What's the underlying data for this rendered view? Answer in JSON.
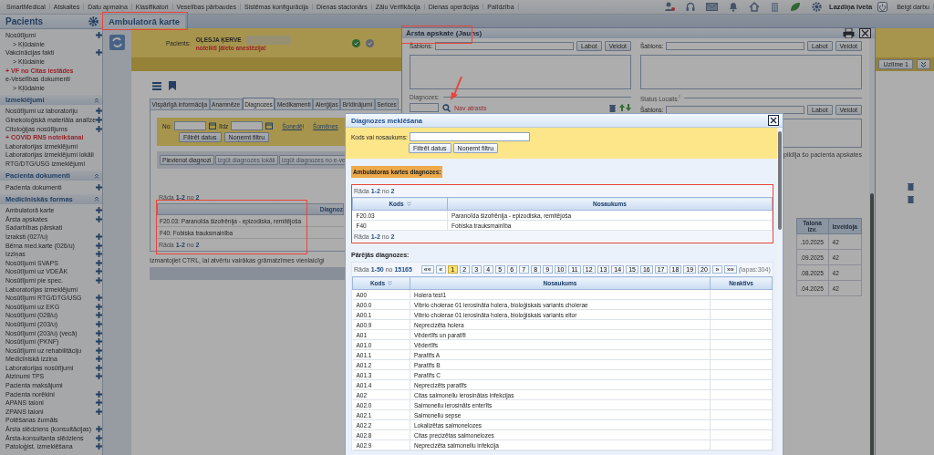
{
  "top_menu": {
    "items": [
      "SmartMedical",
      "Atskaites",
      "Datu apmaiņa",
      "Klasifikatori",
      "Veselības pārbaudes",
      "Sistēmas konfigurācija",
      "Dienas stacionārs",
      "Zāļu Verifikācija",
      "Dienas operācijas",
      "Palīdzība"
    ],
    "user": "Lazdiņa Iveta",
    "logout": "Beigt darbu"
  },
  "sidebar": {
    "title": "Pacients",
    "sections": [
      {
        "items": [
          {
            "label": "Nosūtījumi",
            "kind": "link",
            "add": true
          },
          {
            "label": "> Kļūdainie",
            "kind": "sub",
            "add": false
          },
          {
            "label": "Vakcinācijas fakti",
            "kind": "link",
            "add": true
          },
          {
            "label": "> Kļūdainie",
            "kind": "sub",
            "add": false
          },
          {
            "label": "+ VF no Citas iestādes",
            "kind": "alert",
            "add": false
          },
          {
            "label": "e-Veselības dokumenti",
            "kind": "link",
            "add": false
          },
          {
            "label": "> Kļūdainie",
            "kind": "sub",
            "add": false
          }
        ]
      },
      {
        "title": "Izmeklējumi",
        "items": [
          {
            "label": "Nosūtījumi uz laboratoriju",
            "kind": "link",
            "add": true
          },
          {
            "label": "Ginekoloģiskā materiāla analīze",
            "kind": "link",
            "add": true
          },
          {
            "label": "Citoloģijas nosūtījums",
            "kind": "link",
            "add": true
          },
          {
            "label": "+ COVID RNS noteikšanai",
            "kind": "alert",
            "add": false
          },
          {
            "label": "Laboratorijas izmeklējumi",
            "kind": "link",
            "add": false
          },
          {
            "label": "Laboratorijas izmeklējumi lokāli",
            "kind": "link",
            "add": false
          },
          {
            "label": "RTG/DTG/USG izmeklējumi",
            "kind": "link",
            "add": false
          }
        ]
      },
      {
        "title": "Pacienta dokumenti",
        "items": [
          {
            "label": "Pacienta dokumenti",
            "kind": "link",
            "add": true
          }
        ]
      },
      {
        "title": "Medicīniskās formas",
        "items": [
          {
            "label": "Ambulatorā karte",
            "kind": "link",
            "add": true
          },
          {
            "label": "Ārsta apskates",
            "kind": "link",
            "add": true
          },
          {
            "label": "Sadarbības pārskati",
            "kind": "link",
            "add": false
          },
          {
            "label": "Izraksti (027/u)",
            "kind": "link",
            "add": true
          },
          {
            "label": "Bērna med.karte (026/u)",
            "kind": "link",
            "add": true
          },
          {
            "label": "Izziņas",
            "kind": "link",
            "add": true
          },
          {
            "label": "Nosūtījumi SVAPS",
            "kind": "link",
            "add": true
          },
          {
            "label": "Nosūtījumi uz VDEĀK",
            "kind": "link",
            "add": true
          },
          {
            "label": "Nosūtījumi pie spec.",
            "kind": "link",
            "add": true
          },
          {
            "label": "Laboratorijas izmeklējumi",
            "kind": "link",
            "add": false
          },
          {
            "label": "Nosūtījumi RTG/DTG/USG",
            "kind": "link",
            "add": true
          },
          {
            "label": "Nosūtījumi uz EKG",
            "kind": "link",
            "add": true
          },
          {
            "label": "Nosūtījumi (028/u)",
            "kind": "link",
            "add": true
          },
          {
            "label": "Nosūtījumi (203/u)",
            "kind": "link",
            "add": true
          },
          {
            "label": "Nosūtījumi (203/u) (vecā)",
            "kind": "link",
            "add": true
          },
          {
            "label": "Nosūtījumi (PKNF)",
            "kind": "link",
            "add": true
          },
          {
            "label": "Nosūtījumi uz rehabilitāciju",
            "kind": "link",
            "add": true
          },
          {
            "label": "Medicīniskā izziņa",
            "kind": "link",
            "add": true
          },
          {
            "label": "Laboratorijas nosūtījumi",
            "kind": "link",
            "add": true
          },
          {
            "label": "Atzinumi TPS",
            "kind": "link",
            "add": true
          },
          {
            "label": "Pacienta maksājumi",
            "kind": "link",
            "add": false
          },
          {
            "label": "Pacienta norēķini",
            "kind": "link",
            "add": true
          },
          {
            "label": "APANS taloni",
            "kind": "link",
            "add": true
          },
          {
            "label": "ZPANS taloni",
            "kind": "link",
            "add": true
          },
          {
            "label": "Potēšanas žurnāls",
            "kind": "link",
            "add": false
          },
          {
            "label": "Ārsta slēdziens (konsultācijas)",
            "kind": "link",
            "add": true
          },
          {
            "label": "Ārsta-konsultanta slēdziens",
            "kind": "link",
            "add": true
          },
          {
            "label": "Patoloģist. izmeklēšana",
            "kind": "link",
            "add": true
          }
        ]
      }
    ]
  },
  "page": {
    "title": "Ambulatorā karte",
    "patient_label": "Pacients:",
    "patient_name": "OĻESJA ĶERVE",
    "patient_warning": "noteikti jāleto anestēzija!",
    "sticker_button": "Uzlīme 1",
    "tabs": [
      {
        "label": "Vispārīgā informācija",
        "selected": false
      },
      {
        "label": "Anamnēze",
        "selected": false
      },
      {
        "label": "Diagnozes",
        "selected": true
      },
      {
        "label": "Medikamenti",
        "selected": false
      },
      {
        "label": "Alerģijas",
        "selected": false
      },
      {
        "label": "Brīdinājumi",
        "selected": false
      },
      {
        "label": "Serices",
        "selected": false
      }
    ],
    "filter": {
      "from_label": "No:",
      "to_label": "līdz",
      "links": [
        "Šonedēļ",
        "Šomēnes"
      ],
      "buttons": [
        "Filtrēt datus",
        "Noņemt filtru"
      ]
    },
    "actions": [
      {
        "label": "Pievienot diagnozi",
        "disabled": false
      },
      {
        "label": "Izgūt diagnozes lokāli",
        "disabled": true
      },
      {
        "label": "Izgūt diagnozes no e-ve",
        "disabled": true
      }
    ],
    "count_top": "Rāda **1-2** no **2**",
    "column": "Diagnoz",
    "rows": [
      "F20.03: Paranoīda šizofrēnija - epizodiska, remitējoša",
      "F40: Fobiska trauksmainība"
    ],
    "count_bottom": "Rāda **1-2** no **2**",
    "hint": "Izmantojiet CTRL, lai atvērtu vairākas grāmatzīmes vienlaicīgi"
  },
  "exam_window": {
    "title": "Ārsta apskate (Jauns)",
    "template_label": "Šablons:",
    "buttons": [
      "Labot",
      "Veidot"
    ],
    "diagnoses_label": "Diagnozes:",
    "not_found": "Nav atrasts",
    "status_label": "Status Localis:$^{!}$",
    "right_column": {
      "template_label": "Šablons:",
      "buttons": [
        "Labot",
        "Veidot"
      ]
    },
    "right_template_label": "Šablons:",
    "right_buttons": [
      "Labot",
      "Veidot"
    ],
    "partial_note": "pildīja šo pacienta apskates",
    "table": {
      "columns": [
        "Talona izv.",
        "Izveidoja"
      ],
      "rows": [
        [
          ".10.2025",
          "42"
        ],
        [
          ".09.2025",
          "42"
        ],
        [
          ".08.2025",
          "42"
        ],
        [
          ".04.2025",
          "42"
        ]
      ]
    }
  },
  "dialog": {
    "title": "Diagnozes meklēšana",
    "search_label": "Kods vai nosaukums:",
    "buttons": [
      "Filtrēt datus",
      "Noņemt filtru"
    ],
    "card_label": "Ambulatoras kartes diagnozes:",
    "card_count_top": "Rāda **1-2** no **2**",
    "card_columns": [
      "Kods",
      "Nosaukums"
    ],
    "card_rows": [
      [
        "F20.03",
        "Paranoīda šizofrēnija - epizodiska, remitējoša"
      ],
      [
        "F40",
        "Fobiska trauksmainība"
      ]
    ],
    "card_count_bottom": "Rāda **1-2** no **2**",
    "other_label": "Pārējās diagnozes:",
    "other_count": "Rāda **1-50** no **15165**",
    "pager": {
      "first": "««",
      "prev": "«",
      "next": "»",
      "last": "»»",
      "pages": [
        {
          "label": "1",
          "selected": true
        },
        {
          "label": "2",
          "selected": false
        },
        {
          "label": "3",
          "selected": false
        },
        {
          "label": "4",
          "selected": false
        },
        {
          "label": "5",
          "selected": false
        },
        {
          "label": "6",
          "selected": false
        },
        {
          "label": "7",
          "selected": false
        },
        {
          "label": "8",
          "selected": false
        },
        {
          "label": "9",
          "selected": false
        },
        {
          "label": "10",
          "selected": false
        },
        {
          "label": "11",
          "selected": false
        },
        {
          "label": "12",
          "selected": false
        },
        {
          "label": "13",
          "selected": false
        },
        {
          "label": "14",
          "selected": false
        },
        {
          "label": "15",
          "selected": false
        },
        {
          "label": "16",
          "selected": false
        },
        {
          "label": "17",
          "selected": false
        },
        {
          "label": "18",
          "selected": false
        },
        {
          "label": "19",
          "selected": false
        },
        {
          "label": "20",
          "selected": false
        }
      ],
      "total": "(lapas:304)"
    },
    "columns": [
      "Kods",
      "Nosaukums",
      "Neaktīvs"
    ],
    "rows": [
      [
        "A00",
        "Holera test1"
      ],
      [
        "A00.0",
        "Vibrio cholerae 01 ierosināta holera, bioloģiskais variants cholerae"
      ],
      [
        "A00.1",
        "Vibrio cholerae 01 ierosināta holera, bioloģiskais variants eltor"
      ],
      [
        "A00.9",
        "Neprecizēta holera"
      ],
      [
        "A01",
        "Vēdertīfs un paratīfi"
      ],
      [
        "A01.0",
        "Vēdertīfs"
      ],
      [
        "A01.1",
        "Paratīfs A"
      ],
      [
        "A01.2",
        "Paratīfs B"
      ],
      [
        "A01.3",
        "Paratīfs C"
      ],
      [
        "A01.4",
        "Neprecizēts paratīfs"
      ],
      [
        "A02",
        "Citas salmonellu ierosinātas infekcijas"
      ],
      [
        "A02.0",
        "Salmonellu ierosināts enterīts"
      ],
      [
        "A02.1",
        "Salmonellu sepse"
      ],
      [
        "A02.2",
        "Lokalizētas salmonelozes"
      ],
      [
        "A02.8",
        "Citas precizētas salmonelozes"
      ],
      [
        "A02.9",
        "Neprecizēta salmonellu infekcija"
      ]
    ]
  }
}
